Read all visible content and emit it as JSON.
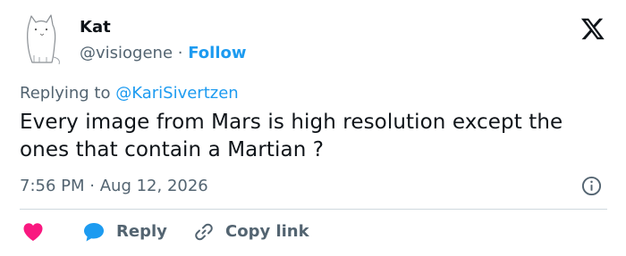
{
  "user": {
    "name": "Kat",
    "handle": "@visiogene",
    "separator": "·",
    "follow_label": "Follow"
  },
  "tweet": {
    "replying_prefix": "Replying to",
    "replying_to": "@KariSivertzen",
    "text": "Every image from Mars is high resolution except the ones that contain a Martian ?",
    "time": "7:56 PM",
    "meta_separator": "·",
    "date": "Aug 12, 2026"
  },
  "actions": {
    "reply_label": "Reply",
    "copy_link_label": "Copy link"
  },
  "icons": {
    "avatar": "cat-sketch-avatar",
    "brand": "x-logo-icon",
    "info": "info-icon",
    "like": "heart-icon",
    "reply": "speech-bubble-icon",
    "copy": "link-icon"
  },
  "colors": {
    "text_primary": "#0f1419",
    "text_secondary": "#536471",
    "accent_blue": "#1d9bf0",
    "like_pink": "#f91880",
    "divider": "#cfd9de"
  }
}
